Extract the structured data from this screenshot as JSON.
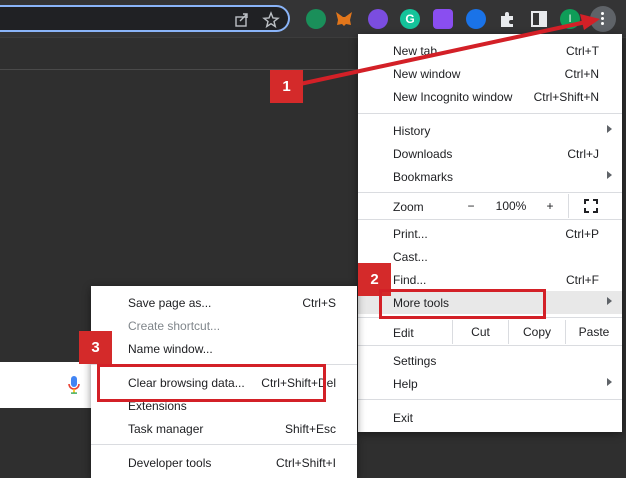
{
  "toolbar": {
    "share_icon": "share-icon",
    "bookmark_icon": "star-icon",
    "extensions": [
      "grammarly-go-icon",
      "metamask-fox-icon",
      "chat-bubble-icon",
      "grammarly-icon",
      "moon-icon",
      "password-manager-icon",
      "puzzle-icon",
      "sidebar-icon"
    ],
    "avatar_letter": "I",
    "menu_icon": "kebab-menu-icon"
  },
  "main_menu": {
    "items": [
      {
        "label": "New tab",
        "shortcut": "Ctrl+T"
      },
      {
        "label": "New window",
        "shortcut": "Ctrl+N"
      },
      {
        "label": "New Incognito window",
        "shortcut": "Ctrl+Shift+N"
      },
      {
        "label": "History",
        "shortcut": ""
      },
      {
        "label": "Downloads",
        "shortcut": "Ctrl+J"
      },
      {
        "label": "Bookmarks",
        "shortcut": ""
      },
      {
        "label": "Print...",
        "shortcut": "Ctrl+P"
      },
      {
        "label": "Cast...",
        "shortcut": ""
      },
      {
        "label": "Find...",
        "shortcut": "Ctrl+F"
      },
      {
        "label": "More tools",
        "shortcut": ""
      },
      {
        "label": "Settings",
        "shortcut": ""
      },
      {
        "label": "Help",
        "shortcut": ""
      },
      {
        "label": "Exit",
        "shortcut": ""
      }
    ],
    "zoom": {
      "label": "Zoom",
      "minus": "−",
      "value": "100%",
      "plus": "+"
    },
    "edit": {
      "label": "Edit",
      "cut": "Cut",
      "copy": "Copy",
      "paste": "Paste"
    }
  },
  "submenu": {
    "items": [
      {
        "label": "Save page as...",
        "shortcut": "Ctrl+S"
      },
      {
        "label": "Create shortcut...",
        "shortcut": ""
      },
      {
        "label": "Name window...",
        "shortcut": ""
      },
      {
        "label": "Clear browsing data...",
        "shortcut": "Ctrl+Shift+Del"
      },
      {
        "label": "Extensions",
        "shortcut": ""
      },
      {
        "label": "Task manager",
        "shortcut": "Shift+Esc"
      },
      {
        "label": "Developer tools",
        "shortcut": "Ctrl+Shift+I"
      }
    ]
  },
  "annotations": {
    "step1": "1",
    "step2": "2",
    "step3": "3"
  },
  "colors": {
    "annotation_red": "#d32027",
    "toolbar": "#343435",
    "background": "#2f2f2f"
  }
}
